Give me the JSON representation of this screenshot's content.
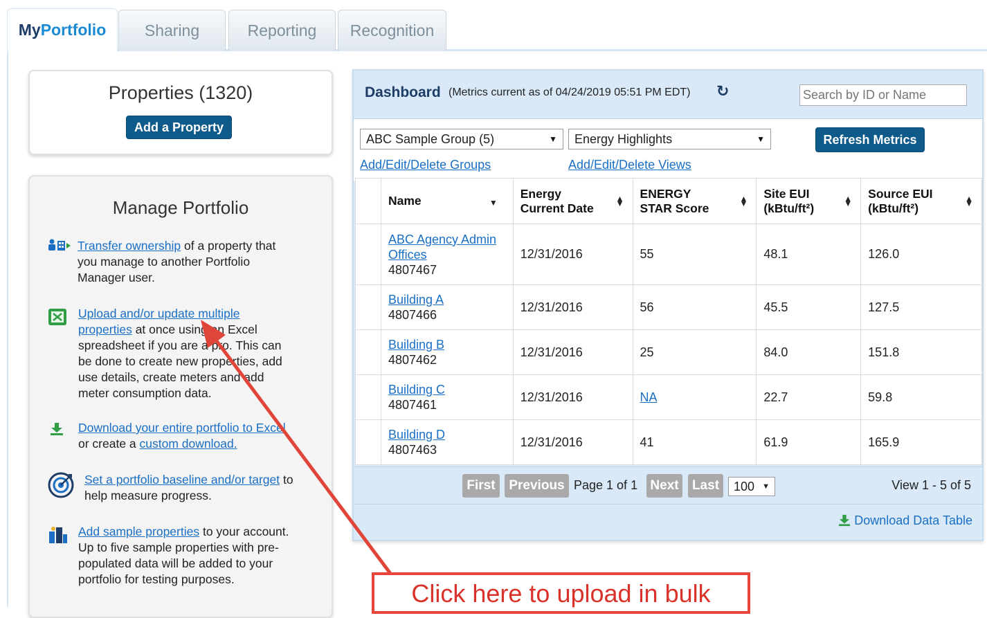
{
  "tabs": [
    {
      "label_my": "My",
      "label_rest": "Portfolio"
    },
    {
      "label": "Sharing"
    },
    {
      "label": "Reporting"
    },
    {
      "label": "Recognition"
    }
  ],
  "properties_panel": {
    "title": "Properties (1320)",
    "add_button": "Add a Property"
  },
  "manage": {
    "title": "Manage Portfolio",
    "transfer": {
      "link": "Transfer ownership",
      "text_a": " of a property that",
      "text_b": "you manage to another Portfolio",
      "text_c": "Manager user."
    },
    "upload": {
      "link_a": "Upload and/or update multiple",
      "link_b": "properties",
      "text_a": " at once using an Excel",
      "text_b": "spreadsheet if you are a pro. This can",
      "text_c": "be done to create new properties, add",
      "text_d": "use details, create meters and add",
      "text_e": "meter consumption data."
    },
    "download": {
      "link": "Download your entire portfolio to Excel",
      "text_a": "or create a ",
      "link_b": "custom download."
    },
    "baseline": {
      "link": "Set a portfolio baseline and/or target",
      "text_a": " to",
      "text_b": "help measure progress."
    },
    "sample": {
      "link": "Add sample properties",
      "text_a": " to your account.",
      "text_b": "Up to five sample properties with pre-",
      "text_c": "populated data will be added to your",
      "text_d": "portfolio for testing purposes."
    }
  },
  "dashboard": {
    "title": "Dashboard",
    "subtitle": "(Metrics current as of 04/24/2019 05:51 PM EDT)",
    "search_placeholder": "Search by ID or Name",
    "group_select": "ABC Sample Group (5)",
    "view_select": "Energy Highlights",
    "refresh_button": "Refresh Metrics",
    "groups_link": "Add/Edit/Delete Groups",
    "views_link": "Add/Edit/Delete Views",
    "columns": {
      "name": "Name",
      "date_a": "Energy",
      "date_b": "Current Date",
      "score_a": "ENERGY",
      "score_b": "STAR Score",
      "site_a": "Site EUI",
      "site_b": "(kBtu/ft²)",
      "source_a": "Source EUI",
      "source_b": "(kBtu/ft²)"
    },
    "rows": [
      {
        "name_a": "ABC Agency Admin",
        "name_b": "Offices",
        "id": "4807467",
        "date": "12/31/2016",
        "score": "55",
        "site": "48.1",
        "source": "126.0"
      },
      {
        "name_a": "Building A",
        "id": "4807466",
        "date": "12/31/2016",
        "score": "56",
        "site": "45.5",
        "source": "127.5"
      },
      {
        "name_a": "Building B",
        "id": "4807462",
        "date": "12/31/2016",
        "score": "25",
        "site": "84.0",
        "source": "151.8"
      },
      {
        "name_a": "Building C",
        "id": "4807461",
        "date": "12/31/2016",
        "score": "NA",
        "site": "22.7",
        "source": "59.8"
      },
      {
        "name_a": "Building D",
        "id": "4807463",
        "date": "12/31/2016",
        "score": "41",
        "site": "61.9",
        "source": "165.9"
      }
    ],
    "pager": {
      "first": "First",
      "previous": "Previous",
      "page_text": "Page 1 of 1",
      "next": "Next",
      "last": "Last",
      "page_size": "100",
      "view_text": "View 1 - 5 of 5"
    },
    "download_link": "Download Data Table"
  },
  "annotation": {
    "text": "Click here to upload in bulk",
    "color": "#e8463a"
  }
}
